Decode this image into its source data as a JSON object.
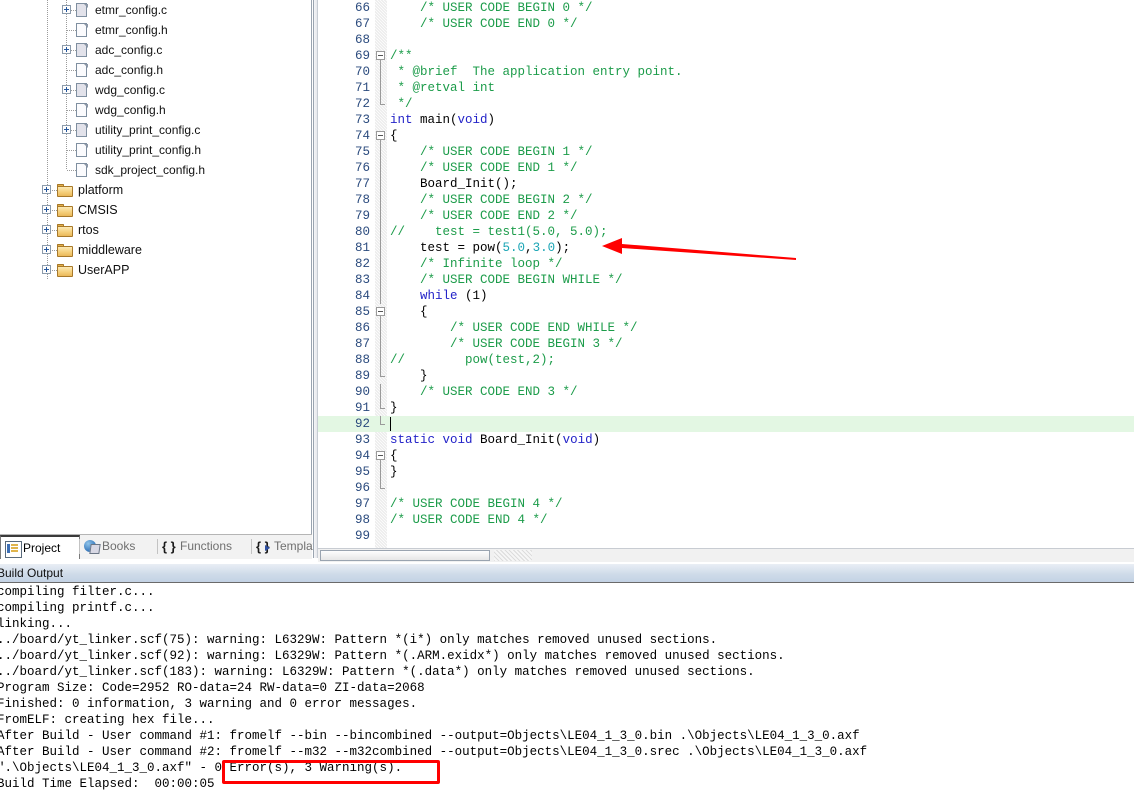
{
  "project_panel": {
    "files": [
      {
        "name": "etmr_config.c",
        "type": "source",
        "expandable": true,
        "indent": 0
      },
      {
        "name": "etmr_config.h",
        "type": "header",
        "expandable": false,
        "indent": 0
      },
      {
        "name": "adc_config.c",
        "type": "source",
        "expandable": true,
        "indent": 0
      },
      {
        "name": "adc_config.h",
        "type": "header",
        "expandable": false,
        "indent": 0
      },
      {
        "name": "wdg_config.c",
        "type": "source",
        "expandable": true,
        "indent": 0
      },
      {
        "name": "wdg_config.h",
        "type": "header",
        "expandable": false,
        "indent": 0
      },
      {
        "name": "utility_print_config.c",
        "type": "source",
        "expandable": true,
        "indent": 0
      },
      {
        "name": "utility_print_config.h",
        "type": "header",
        "expandable": false,
        "indent": 0
      },
      {
        "name": "sdk_project_config.h",
        "type": "header",
        "expandable": false,
        "indent": 0
      }
    ],
    "folders": [
      {
        "name": "platform",
        "expandable": true
      },
      {
        "name": "CMSIS",
        "expandable": true
      },
      {
        "name": "rtos",
        "expandable": true
      },
      {
        "name": "middleware",
        "expandable": true
      },
      {
        "name": "UserAPP",
        "expandable": true
      }
    ],
    "tabs": [
      {
        "label": "Project",
        "icon": "project-icon",
        "active": true
      },
      {
        "label": "Books",
        "icon": "books-icon",
        "active": false
      },
      {
        "label": "Functions",
        "icon": "functions-icon",
        "active": false
      },
      {
        "label": "Templates",
        "icon": "templates-icon",
        "active": false
      }
    ]
  },
  "editor": {
    "first_line_number": 66,
    "current_line": 92,
    "lines": [
      {
        "n": 66,
        "tokens": [
          {
            "t": "    ",
            "c": "pln"
          },
          {
            "t": "/* USER CODE BEGIN 0 */",
            "c": "cmt"
          }
        ]
      },
      {
        "n": 67,
        "tokens": [
          {
            "t": "    ",
            "c": "pln"
          },
          {
            "t": "/* USER CODE END 0 */",
            "c": "cmt"
          }
        ]
      },
      {
        "n": 68,
        "tokens": []
      },
      {
        "n": 69,
        "fold": "start",
        "tokens": [
          {
            "t": "/**",
            "c": "cmt"
          }
        ]
      },
      {
        "n": 70,
        "fold": "mid",
        "tokens": [
          {
            "t": " * @brief  The application entry point.",
            "c": "cmt"
          }
        ]
      },
      {
        "n": 71,
        "fold": "mid",
        "tokens": [
          {
            "t": " * @retval int",
            "c": "cmt"
          }
        ]
      },
      {
        "n": 72,
        "fold": "end",
        "tokens": [
          {
            "t": " */",
            "c": "cmt"
          }
        ]
      },
      {
        "n": 73,
        "tokens": [
          {
            "t": "int",
            "c": "kw"
          },
          {
            "t": " main(",
            "c": "pln"
          },
          {
            "t": "void",
            "c": "kw"
          },
          {
            "t": ")",
            "c": "pln"
          }
        ]
      },
      {
        "n": 74,
        "fold": "start",
        "tokens": [
          {
            "t": "{",
            "c": "pln"
          }
        ]
      },
      {
        "n": 75,
        "fold": "mid",
        "tokens": [
          {
            "t": "    ",
            "c": "pln"
          },
          {
            "t": "/* USER CODE BEGIN 1 */",
            "c": "cmt"
          }
        ]
      },
      {
        "n": 76,
        "fold": "mid",
        "tokens": [
          {
            "t": "    ",
            "c": "pln"
          },
          {
            "t": "/* USER CODE END 1 */",
            "c": "cmt"
          }
        ]
      },
      {
        "n": 77,
        "fold": "mid",
        "tokens": [
          {
            "t": "    Board_Init();",
            "c": "pln"
          }
        ]
      },
      {
        "n": 78,
        "fold": "mid",
        "tokens": [
          {
            "t": "    ",
            "c": "pln"
          },
          {
            "t": "/* USER CODE BEGIN 2 */",
            "c": "cmt"
          }
        ]
      },
      {
        "n": 79,
        "fold": "mid",
        "tokens": [
          {
            "t": "    ",
            "c": "pln"
          },
          {
            "t": "/* USER CODE END 2 */",
            "c": "cmt"
          }
        ]
      },
      {
        "n": 80,
        "fold": "mid",
        "tokens": [
          {
            "t": "//    test = test1(5.0, 5.0);",
            "c": "slc"
          }
        ]
      },
      {
        "n": 81,
        "fold": "mid",
        "tokens": [
          {
            "t": "    test = pow(",
            "c": "pln"
          },
          {
            "t": "5.0",
            "c": "num"
          },
          {
            "t": ",",
            "c": "pln"
          },
          {
            "t": "3.0",
            "c": "num"
          },
          {
            "t": ");",
            "c": "pln"
          }
        ]
      },
      {
        "n": 82,
        "fold": "mid",
        "tokens": [
          {
            "t": "    ",
            "c": "pln"
          },
          {
            "t": "/* Infinite loop */",
            "c": "cmt"
          }
        ]
      },
      {
        "n": 83,
        "fold": "mid",
        "tokens": [
          {
            "t": "    ",
            "c": "pln"
          },
          {
            "t": "/* USER CODE BEGIN WHILE */",
            "c": "cmt"
          }
        ]
      },
      {
        "n": 84,
        "fold": "mid",
        "tokens": [
          {
            "t": "    ",
            "c": "pln"
          },
          {
            "t": "while",
            "c": "kw"
          },
          {
            "t": " (1)",
            "c": "pln"
          }
        ]
      },
      {
        "n": 85,
        "fold": "start2",
        "tokens": [
          {
            "t": "    {",
            "c": "pln"
          }
        ]
      },
      {
        "n": 86,
        "fold": "mid2",
        "tokens": [
          {
            "t": "        ",
            "c": "pln"
          },
          {
            "t": "/* USER CODE END WHILE */",
            "c": "cmt"
          }
        ]
      },
      {
        "n": 87,
        "fold": "mid2",
        "tokens": [
          {
            "t": "        ",
            "c": "pln"
          },
          {
            "t": "/* USER CODE BEGIN 3 */",
            "c": "cmt"
          }
        ]
      },
      {
        "n": 88,
        "fold": "mid2",
        "tokens": [
          {
            "t": "//        pow(test,2);",
            "c": "slc"
          }
        ]
      },
      {
        "n": 89,
        "fold": "end2",
        "tokens": [
          {
            "t": "    }",
            "c": "pln"
          }
        ]
      },
      {
        "n": 90,
        "fold": "mid",
        "tokens": [
          {
            "t": "    ",
            "c": "pln"
          },
          {
            "t": "/* USER CODE END 3 */",
            "c": "cmt"
          }
        ]
      },
      {
        "n": 91,
        "fold": "end",
        "tokens": [
          {
            "t": "}",
            "c": "pln"
          }
        ]
      },
      {
        "n": 92,
        "fold": "endtick",
        "current": true,
        "tokens": []
      },
      {
        "n": 93,
        "tokens": [
          {
            "t": "static",
            "c": "kw"
          },
          {
            "t": " ",
            "c": "pln"
          },
          {
            "t": "void",
            "c": "kw"
          },
          {
            "t": " Board_Init(",
            "c": "pln"
          },
          {
            "t": "void",
            "c": "kw"
          },
          {
            "t": ")",
            "c": "pln"
          }
        ]
      },
      {
        "n": 94,
        "fold": "start",
        "tokens": [
          {
            "t": "{",
            "c": "pln"
          }
        ]
      },
      {
        "n": 95,
        "fold": "mid",
        "tokens": [
          {
            "t": "}",
            "c": "pln"
          }
        ]
      },
      {
        "n": 96,
        "fold": "end",
        "tokens": []
      },
      {
        "n": 97,
        "tokens": [
          {
            "t": "/* USER CODE BEGIN 4 */",
            "c": "cmt"
          }
        ]
      },
      {
        "n": 98,
        "tokens": [
          {
            "t": "/* USER CODE END 4 */",
            "c": "cmt"
          }
        ]
      },
      {
        "n": 99,
        "tokens": []
      }
    ]
  },
  "build_output": {
    "title": "Build Output",
    "lines": [
      "compiling filter.c...",
      "compiling printf.c...",
      "linking...",
      "../board/yt_linker.scf(75): warning: L6329W: Pattern *(i*) only matches removed unused sections.",
      "../board/yt_linker.scf(92): warning: L6329W: Pattern *(.ARM.exidx*) only matches removed unused sections.",
      "../board/yt_linker.scf(183): warning: L6329W: Pattern *(.data*) only matches removed unused sections.",
      "Program Size: Code=2952 RO-data=24 RW-data=0 ZI-data=2068",
      "Finished: 0 information, 3 warning and 0 error messages.",
      "FromELF: creating hex file...",
      "After Build - User command #1: fromelf --bin --bincombined --output=Objects\\LE04_1_3_0.bin .\\Objects\\LE04_1_3_0.axf",
      "After Build - User command #2: fromelf --m32 --m32combined --output=Objects\\LE04_1_3_0.srec .\\Objects\\LE04_1_3_0.axf",
      "\".\\Objects\\LE04_1_3_0.axf\" - 0 Error(s), 3 Warning(s).",
      "Build Time Elapsed:  00:00:05"
    ]
  },
  "annotations": {
    "arrow": {
      "name": "red-arrow",
      "points_to": "test = pow(5.0,3.0);",
      "color": "#ff0000"
    },
    "highlight_box": {
      "name": "red-highlight-box",
      "text": "0 Error(s), 3 Warning(s).",
      "color": "#ff0000"
    }
  },
  "colors": {
    "comment": "#1c9c4a",
    "keyword": "#2323c8",
    "number": "#1aa5b5",
    "line_number": "#2b4b7e",
    "current_line_bg": "#e3f7e3",
    "annotation_red": "#ff0000"
  }
}
